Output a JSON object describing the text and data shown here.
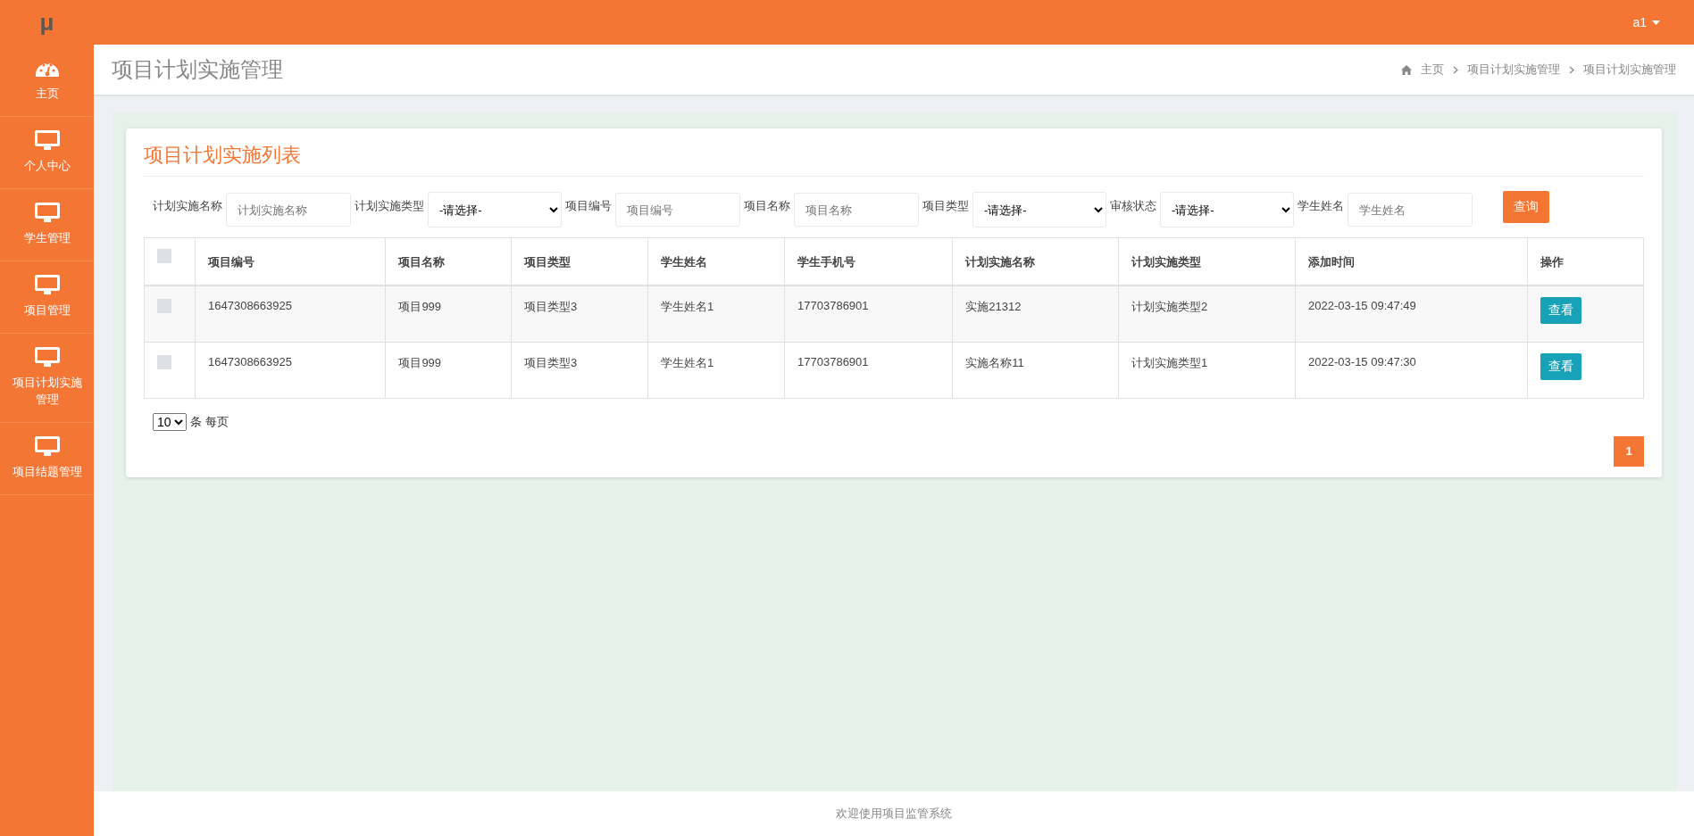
{
  "topbar": {
    "logo": "μ",
    "user": "a1"
  },
  "sidebar": {
    "items": [
      {
        "label": "主页",
        "kind": "dashboard"
      },
      {
        "label": "个人中心",
        "kind": "page"
      },
      {
        "label": "学生管理",
        "kind": "page"
      },
      {
        "label": "项目管理",
        "kind": "page"
      },
      {
        "label": "项目计划实施管理",
        "kind": "page"
      },
      {
        "label": "项目结题管理",
        "kind": "page"
      }
    ]
  },
  "header": {
    "title": "项目计划实施管理",
    "breadcrumb": [
      "主页",
      "项目计划实施管理",
      "项目计划实施管理"
    ]
  },
  "card": {
    "title": "项目计划实施列表",
    "filters": [
      {
        "kind": "text",
        "label": "计划实施名称",
        "placeholder": "计划实施名称"
      },
      {
        "kind": "select",
        "label": "计划实施类型",
        "value": "-请选择-"
      },
      {
        "kind": "text",
        "label": "项目编号",
        "placeholder": "项目编号"
      },
      {
        "kind": "text",
        "label": "项目名称",
        "placeholder": "项目名称"
      },
      {
        "kind": "select",
        "label": "项目类型",
        "value": "-请选择-"
      },
      {
        "kind": "select",
        "label": "审核状态",
        "value": "-请选择-"
      },
      {
        "kind": "text",
        "label": "学生姓名",
        "placeholder": "学生姓名"
      }
    ],
    "search_button": "查询",
    "table": {
      "all_checked": false,
      "columns": [
        "项目编号",
        "项目名称",
        "项目类型",
        "学生姓名",
        "学生手机号",
        "计划实施名称",
        "计划实施类型",
        "添加时间",
        "操作"
      ],
      "rows": [
        {
          "checked": false,
          "cells": [
            "1647308663925",
            "项目999",
            "项目类型3",
            "学生姓名1",
            "17703786901",
            "实施21312",
            "计划实施类型2",
            "2022-03-15 09:47:49"
          ],
          "action": "查看"
        },
        {
          "checked": false,
          "cells": [
            "1647308663925",
            "项目999",
            "项目类型3",
            "学生姓名1",
            "17703786901",
            "实施名称11",
            "计划实施类型1",
            "2022-03-15 09:47:30"
          ],
          "action": "查看"
        }
      ]
    },
    "page_size": "10",
    "page_size_label": "条 每页",
    "pages": [
      {
        "label": "1",
        "selected": true
      }
    ]
  },
  "footer": "欢迎使用项目监管系统"
}
